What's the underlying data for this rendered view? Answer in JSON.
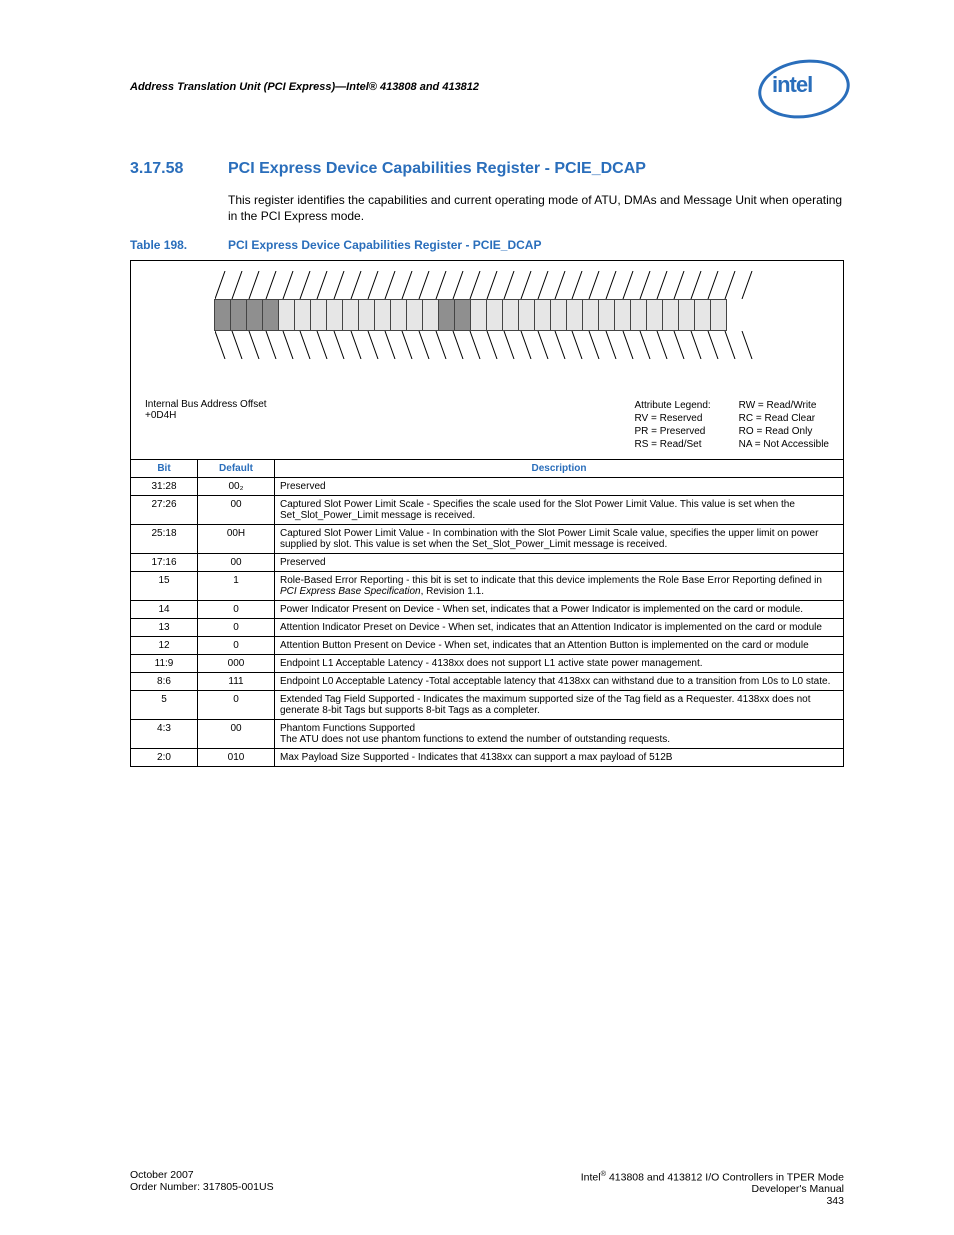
{
  "header": {
    "left": "Address Translation Unit (PCI Express)—Intel® 413808 and 413812"
  },
  "logo_text": "intel",
  "section": {
    "num": "3.17.58",
    "title": "PCI Express Device Capabilities Register - PCIE_DCAP",
    "desc": "This register identifies the capabilities and current operating mode of ATU, DMAs and Message Unit when operating in the PCI Express mode."
  },
  "table_caption": {
    "num": "Table 198.",
    "title": "PCI Express Device Capabilities Register - PCIE_DCAP"
  },
  "legend": {
    "offset_label": "Internal Bus Address Offset",
    "offset_value": "+0D4H",
    "attr": "Attribute Legend:",
    "c1": [
      "RV = Reserved",
      "PR = Preserved",
      "RS = Read/Set"
    ],
    "c2": [
      "RW = Read/Write",
      "RC = Read Clear",
      "RO = Read Only",
      "NA = Not Accessible"
    ]
  },
  "columns": {
    "bit": "Bit",
    "def": "Default",
    "desc": "Description"
  },
  "rows": [
    {
      "bit": "31:28",
      "def": "00₂",
      "desc": "Preserved"
    },
    {
      "bit": "27:26",
      "def": "00",
      "desc": "Captured Slot Power Limit Scale - Specifies the scale used for the Slot Power Limit Value. This value is set when the Set_Slot_Power_Limit message is received."
    },
    {
      "bit": "25:18",
      "def": "00H",
      "desc": "Captured Slot Power Limit Value - In combination with the Slot Power Limit Scale value, specifies the upper limit on power supplied by slot. This value is set when the Set_Slot_Power_Limit message is received."
    },
    {
      "bit": "17:16",
      "def": "00",
      "desc": "Preserved"
    },
    {
      "bit": "15",
      "def": "1",
      "desc": "Role-Based Error Reporting - this bit is set to indicate that this device implements the Role Base Error Reporting defined in <i>PCI Express Base Specification</i>, Revision 1.1."
    },
    {
      "bit": "14",
      "def": "0",
      "desc": "Power Indicator Present on Device - When set, indicates that a Power Indicator is implemented on the card or module."
    },
    {
      "bit": "13",
      "def": "0",
      "desc": "Attention Indicator Preset on Device - When set, indicates that an Attention Indicator is implemented on the card or module"
    },
    {
      "bit": "12",
      "def": "0",
      "desc": "Attention Button Present on Device - When set, indicates that an Attention Button is implemented on the card or module"
    },
    {
      "bit": "11:9",
      "def": "000",
      "desc": "Endpoint L1 Acceptable Latency - 4138xx does not support L1 active state power management."
    },
    {
      "bit": "8:6",
      "def": "111",
      "desc": "Endpoint L0 Acceptable Latency -Total acceptable latency that 4138xx can withstand due to a transition from L0s to L0 state."
    },
    {
      "bit": "5",
      "def": "0",
      "desc": "Extended Tag Field Supported - Indicates the maximum supported size of the Tag field as a Requester. 4138xx does not generate 8-bit Tags but supports 8-bit Tags as a completer."
    },
    {
      "bit": "4:3",
      "def": "00",
      "desc": "Phantom Functions Supported<br>The ATU does not use phantom functions to extend the number of outstanding requests."
    },
    {
      "bit": "2:0",
      "def": "010",
      "desc": "Max Payload Size Supported - Indicates that 4138xx can support a max payload of 512B"
    }
  ],
  "footer": {
    "left1": "October 2007",
    "left2": "Order Number: 317805-001US",
    "right1": "Intel® 413808 and 413812 I/O Controllers in TPER Mode",
    "right2": "Developer's Manual",
    "right3": "343"
  }
}
